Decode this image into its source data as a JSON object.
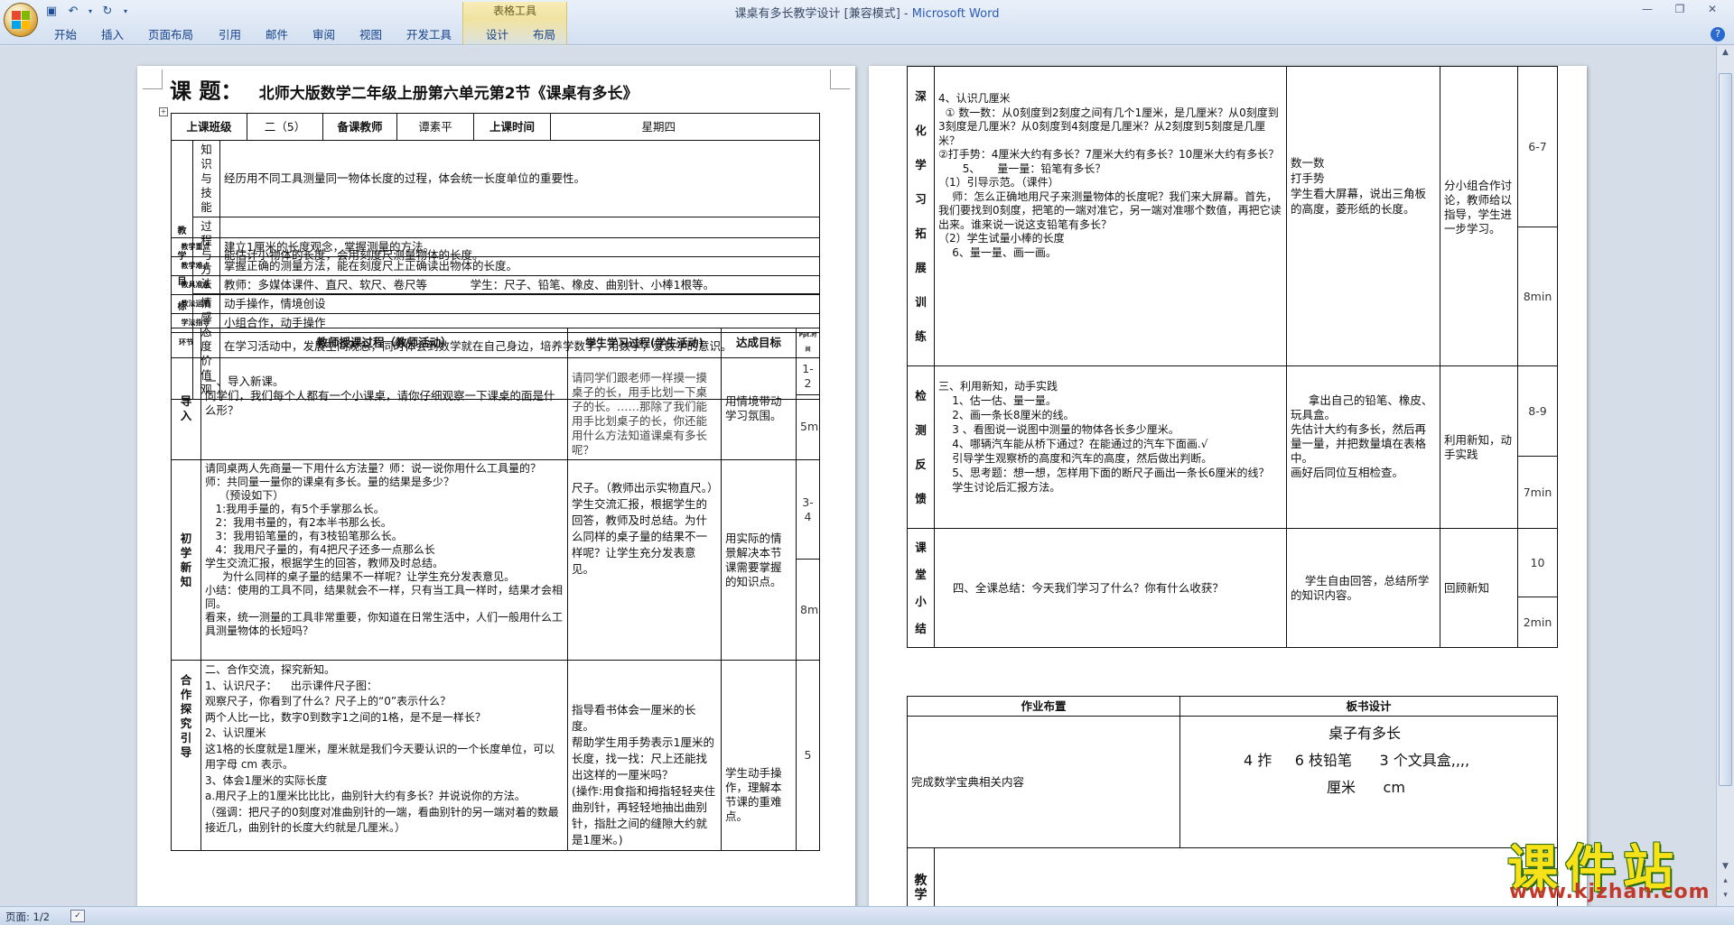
{
  "app": {
    "title": "课桌有多长教学设计 [兼容模式]",
    "separator": " - ",
    "app_name": "Microsoft Word",
    "context_group": "表格工具",
    "tabs": [
      "开始",
      "插入",
      "页面布局",
      "引用",
      "邮件",
      "审阅",
      "视图",
      "开发工具",
      "设计",
      "布局"
    ],
    "status_page": "页面: 1/2"
  },
  "page1": {
    "course_label": "课  题：",
    "course_title": "北师大版数学二年级上册第六单元第2节《课桌有多长》",
    "class_label": "上课班级",
    "class_value": "二（5）",
    "teacher_label": "备课教师",
    "teacher_value": "谭素平",
    "time_label": "上课时间",
    "time_value": "星期四",
    "goals_label": "教学目标",
    "goal_sub": [
      "知识与技能",
      "过程与方法",
      "情感态度价值观"
    ],
    "goals": [
      "经历用不同工具测量同一物体长度的过程，体会统一长度单位的重要性。",
      "能估计小物体的长度，会用刻度尺测量物体的长度。",
      "在学习活动中，发展空间观念，同时体会到数学就在自己身边，培养学数学，用数学，爱数学的意识。"
    ],
    "rows": [
      {
        "label": "教学重点",
        "text": "建立1厘米的长度观念，掌握测量的方法。"
      },
      {
        "label": "教学难点",
        "text": "掌握正确的测量方法，能在刻度尺上正确读出物体的长度。"
      },
      {
        "label": "教具准备",
        "text": "教师：多媒体课件、直尺、软尺、卷尺等            学生：尺子、铅笔、橡皮、曲别针、小棒1根等。"
      },
      {
        "label": "教法运用",
        "text": "动手操作，情境创设"
      },
      {
        "label": "学法指导",
        "text": "小组合作，动手操作"
      }
    ],
    "process_header": {
      "phase": "环节",
      "teacher": "教师授课过程（教师活动）",
      "student": "学生学习过程(学生活动)",
      "goal": "达成目标",
      "time": "Ppt.时间"
    },
    "sections": [
      {
        "phase": "导入",
        "teacher": [
          "一、导入新课。",
          "同学们，我们每个人都有一个小课桌，请你仔细观察一下课桌的面是什么形？"
        ],
        "student": "请同学们跟老师一样摸一摸桌子的长，用手比划一下桌子的长。……那除了我们能用手比划桌子的长，你还能用什么方法知道课桌有多长呢？",
        "goal": "用情境带动学习氛围。",
        "times": [
          "1-2",
          "5min"
        ]
      },
      {
        "phase": "初学新知",
        "teacher": [
          "请同桌两人先商量一下用什么方法量？师：说一说你用什么工具量的？  师：共同量一量你的课桌有多长。量的结果是多少？",
          "    （预设如下）",
          "   1:我用手量的，有5个手掌那么长。",
          "   2：我用书量的，有2本半书那么长。",
          "   3：我用铅笔量的，有3枝铅笔那么长。",
          "   4：我用尺子量的，有4把尺子还多一点那么长",
          "学生交流汇报，根据学生的回答，教师及时总结。",
          "     为什么同样的桌子量的结果不一样呢？让学生充分发表意见。",
          "小结：使用的工具不同，结果就会不一样，只有当工具一样时，结果才会相同。",
          "看来，统一测量的工具非常重要，你知道在日常生活中，人们一般用什么工具测量物体的长短吗？"
        ],
        "student": [
          "尺子。（教师出示实物直尺。）",
          "",
          "学生交流汇报，根据学生的回答，教师及时总结。为什么同样的桌子量的结果不一样呢？让学生充分发表意见。"
        ],
        "goal": "用实际的情景解决本节课需要掌握的知识点。",
        "times": [
          "3-4",
          "8min"
        ]
      },
      {
        "phase": "合作探究引导",
        "teacher": [
          "二、合作交流，探究新知。",
          "1、认识尺子：    出示课件尺子图：",
          "观察尺子，你看到了什么？尺子上的“0”表示什么？",
          "两个人比一比，数字0到数字1之间的1格，是不是一样长？",
          "2、认识厘米",
          "这1格的长度就是1厘米，厘米就是我们今天要认识的一个长度单位，可以用字母 cm 表示。",
          "3、体会1厘米的实际长度",
          "a.用尺子上的1厘米比比比，曲别针大约有多长？并说说你的方法。",
          "（强调：把尺子的0刻度对准曲别针的一端，看曲别针的另一端对着的数最接近几，曲别针的长度大约就是几厘米。）"
        ],
        "student": [
          "指导看书体会一厘米的长度。",
          "帮助学生用手势表示1厘米的长度，找一找：尺上还能找出这样的一厘米吗？",
          "(操作:用食指和拇指轻轻夹住曲别针，再轻轻地抽出曲别针，指肚之间的缝隙大约就是1厘米。)"
        ],
        "goal": "学生动手操作，理解本节课的重难点。",
        "times": [
          "5"
        ]
      }
    ]
  },
  "page2": {
    "sections": [
      {
        "phase": "深化学习拓展训练",
        "teacher": [
          "4、认识几厘米",
          "  ① 数一数：从0刻度到2刻度之间有几个1厘米，是几厘米？从0刻度到3刻度是几厘米？从0刻度到4刻度是几厘米？从2刻度到5刻度是几厘米？",
          "②打手势：4厘米大约有多长？7厘米大约有多长？10厘米大约有多长？",
          "       5、     量一量：铅笔有多长？",
          "",
          "（1）引导示范。（课件）",
          "    师：怎么正确地用尺子来测量物体的长度呢？我们来大屏幕。首先，我们要找到0刻度，把笔的一端对准它，另一端对准哪个数值，再把它读出来。谁来说一说这支铅笔有多长？",
          "（2）学生试量小棒的长度",
          "",
          "    6、量一量、画一画。"
        ],
        "student": [
          "数一数",
          "",
          "打手势",
          "",
          "学生看大屏幕，说出三角板的高度，菱形纸的长度。"
        ],
        "goal": "分小组合作讨论，教师给以指导，学生进一步学习。",
        "times": [
          "6-7",
          "8min"
        ]
      },
      {
        "phase": "检测反馈",
        "teacher": [
          "三、利用新知，动手实践",
          "    1、估一估、量一量。",
          "    2、画一条长8厘米的线。",
          "    3 、看图说一说图中测量的物体各长多少厘米。",
          "    4、哪辆汽车能从桥下通过？在能通过的汽车下面画.√",
          "    引导学生观察桥的高度和汽车的高度，然后做出判断。",
          "    5、思考题：想一想，怎样用下面的断尺子画出一条长6厘米的线？",
          "    学生讨论后汇报方法。"
        ],
        "student": [
          "     拿出自己的铅笔、橡皮、玩具盒。",
          "先估计大约有多长，然后再量一量，并把数量填在表格中。",
          "画好后同位互相检查。"
        ],
        "goal": "利用新知，动手实践",
        "times": [
          "8-9",
          "7min"
        ]
      },
      {
        "phase": "课堂小结",
        "teacher": [
          "    四、全课总结：今天我们学习了什么？你有什么收获？"
        ],
        "student": [
          "    学生自由回答，总结所学的知识内容。"
        ],
        "goal": "回顾新知",
        "times": [
          "10",
          "2min"
        ]
      }
    ],
    "homework_label": "作业布置",
    "board_label": "板书设计",
    "homework_text": "完成数学宝典相关内容",
    "board_lines": [
      "桌子有多长",
      "4 拃     6 枝铅笔      3 个文具盒,,,,",
      "厘米      cm"
    ],
    "reflection_label": "教学"
  },
  "watermark": {
    "main": "课件站",
    "url": "www.kjzhan.com"
  },
  "colors": {
    "ribbon_text": "#15428b",
    "context_tab_bg": "#f0e2a0",
    "workspace_bg": "#d5dde8"
  }
}
